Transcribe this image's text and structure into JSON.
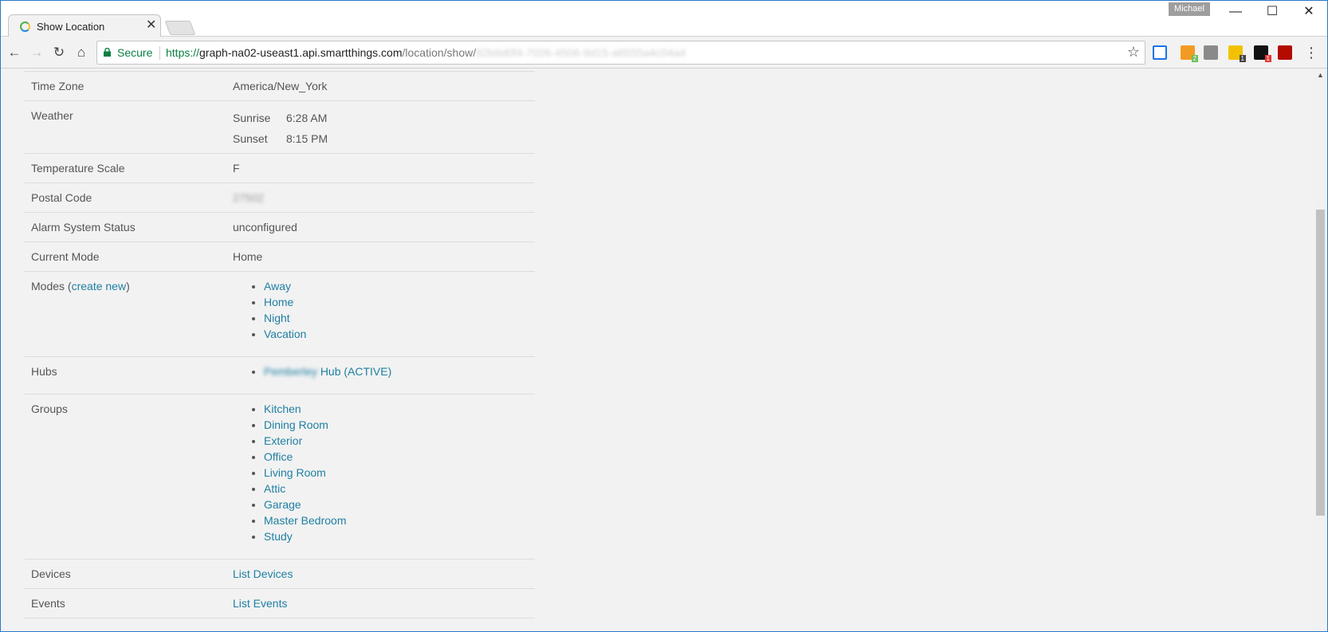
{
  "browser": {
    "tab_title": "Show Location",
    "profile_name": "Michael",
    "secure_label": "Secure",
    "url_scheme": "https://",
    "url_host": "graph-na02-useast1.api.smartthings.com",
    "url_path": "/location/show/",
    "url_hidden": "62b6d0f4-7026-4506-9d15-a6555a4c04a4"
  },
  "rows": {
    "time_zone": {
      "label": "Time Zone",
      "value": "America/New_York"
    },
    "weather": {
      "label": "Weather",
      "sunrise_label": "Sunrise",
      "sunrise": "6:28 AM",
      "sunset_label": "Sunset",
      "sunset": "8:15 PM"
    },
    "temperature_scale": {
      "label": "Temperature Scale",
      "value": "F"
    },
    "postal_code": {
      "label": "Postal Code",
      "value": "27502"
    },
    "alarm": {
      "label": "Alarm System Status",
      "value": "unconfigured"
    },
    "current_mode": {
      "label": "Current Mode",
      "value": "Home"
    },
    "modes": {
      "label_prefix": "Modes (",
      "create_link": "create new",
      "label_suffix": ")",
      "items": [
        "Away",
        "Home",
        "Night",
        "Vacation"
      ]
    },
    "hubs": {
      "label": "Hubs",
      "hub_name_hidden": "Pemberley",
      "hub_suffix": "Hub (ACTIVE)"
    },
    "groups": {
      "label": "Groups",
      "items": [
        "Kitchen",
        "Dining Room",
        "Exterior",
        "Office",
        "Living Room",
        "Attic",
        "Garage",
        "Master Bedroom",
        "Study"
      ]
    },
    "devices": {
      "label": "Devices",
      "link": "List Devices"
    },
    "events": {
      "label": "Events",
      "link": "List Events"
    }
  },
  "colors": {
    "link": "#1f7fa3",
    "secure": "#0b8043",
    "text": "#555555",
    "background": "#f2f2f2"
  }
}
